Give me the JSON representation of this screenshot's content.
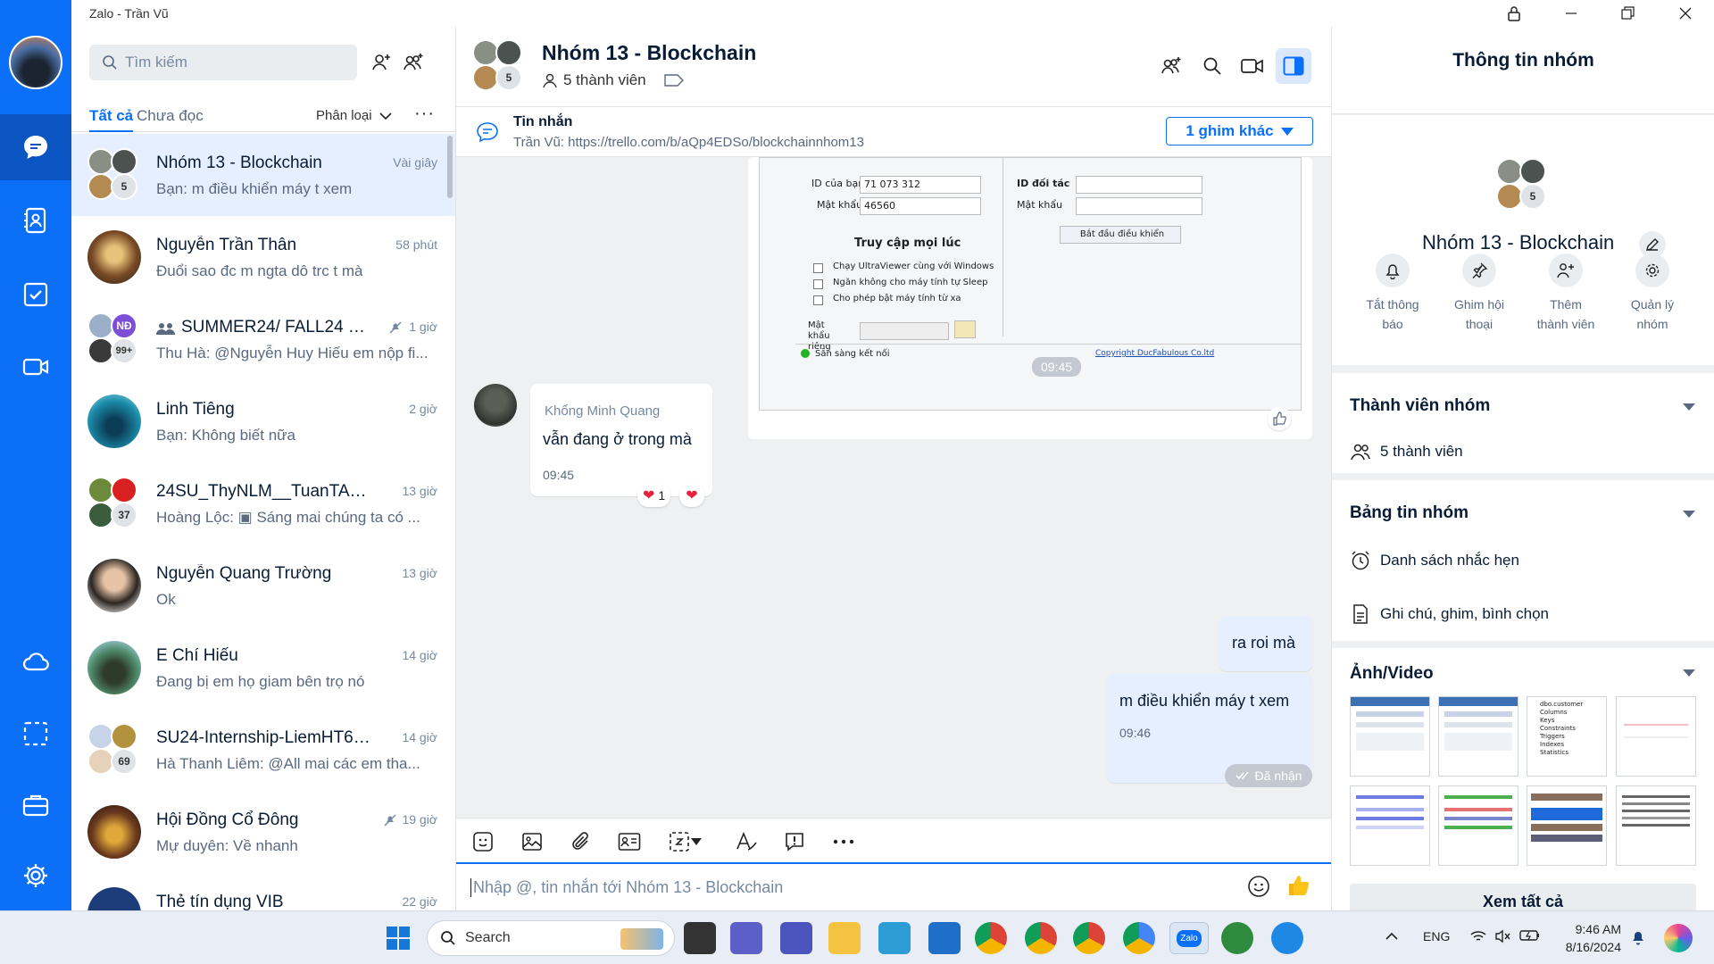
{
  "window": {
    "title": "Zalo - Trần Vũ"
  },
  "convlist": {
    "search_placeholder": "Tìm kiếm",
    "tab_all": "Tất cả",
    "tab_unread": "Chưa đọc",
    "filter": "Phân loại",
    "more": "···",
    "items": [
      {
        "name": "Nhóm 13 - Blockchain",
        "time": "Vài giây",
        "preview": "Bạn: m điều khiển máy t xem",
        "count": "5"
      },
      {
        "name": "Nguyễn Trần Thân",
        "time": "58 phút",
        "preview": "Đuổi sao đc m ngta dô trc t mà"
      },
      {
        "name": "SUMMER24/ FALL24 - ...",
        "time": "1 giờ",
        "preview": "Thu Hà: @Nguyễn Huy Hiếu em nộp fi...",
        "count": "99+",
        "badge": "NĐ"
      },
      {
        "name": "Linh Tiêng",
        "time": "2 giờ",
        "preview": "Bạn: Không biết nữa"
      },
      {
        "name": "24SU_ThyNLM__TuanTA_TT...",
        "time": "13 giờ",
        "preview": "Hoàng Lộc: ▣ Sáng mai chúng ta có ...",
        "count": "37"
      },
      {
        "name": "Nguyễn Quang Trường",
        "time": "13 giờ",
        "preview": "Ok"
      },
      {
        "name": "E Chí Hiếu",
        "time": "14 giờ",
        "preview": "Đang bị em họ giam bên trọ nó"
      },
      {
        "name": "SU24-Internship-LiemHT6_...",
        "time": "14 giờ",
        "preview": "Hà Thanh Liêm: @All mai các em tha...",
        "count": "69"
      },
      {
        "name": "Hội Đồng Cổ Đông",
        "time": "19 giờ",
        "preview": "Mự duyên: Về nhanh"
      },
      {
        "name": "Thẻ tín dụng VIB",
        "time": "22 giờ",
        "preview": ""
      }
    ]
  },
  "chat": {
    "title": "Nhóm 13 - Blockchain",
    "members": "5 thành viên",
    "avatar_count": "5",
    "pin_label": "Tin nhắn",
    "pin_text": "Trần Vũ: https://trello.com/b/aQp4EDSo/blockchainnhom13",
    "pin_button": "1 ghim khác",
    "image_time": "09:45",
    "ultraviewer": {
      "your_id_label": "ID của bạn",
      "your_id": "71 073 312",
      "password_label": "Mật khẩu",
      "password": "46560",
      "partner_id_label": "ID đối tác",
      "partner_password_label": "Mật khẩu",
      "start_button": "Bắt đầu điều khiển",
      "access_title": "Truy cập mọi lúc",
      "opt1": "Chạy UltraViewer cùng với Windows",
      "opt2": "Ngăn không cho máy tính tự Sleep",
      "opt3": "Cho phép bật máy tính từ xa",
      "private_pw_label": "Mật khẩu riêng",
      "status": "Sẵn sàng kết nối",
      "copyright": "Copyright DucFabulous Co.ltd"
    },
    "msg1": {
      "sender": "Khổng Minh Quang",
      "text": "vẫn đang ở trong mà",
      "time": "09:45",
      "reaction_count": "1"
    },
    "msg2": {
      "text": "ra roi mà"
    },
    "msg3": {
      "text": "m điều khiển máy t xem",
      "time": "09:46"
    },
    "received": "Đã nhận",
    "composer_placeholder": "Nhập @, tin nhắn tới Nhóm 13 - Blockchain"
  },
  "info": {
    "title": "Thông tin nhóm",
    "group_name": "Nhóm 13 - Blockchain",
    "avatar_count": "5",
    "actions": [
      {
        "l1": "Tắt thông",
        "l2": "báo"
      },
      {
        "l1": "Ghim hội",
        "l2": "thoại"
      },
      {
        "l1": "Thêm",
        "l2": "thành viên"
      },
      {
        "l1": "Quản lý",
        "l2": "nhóm"
      }
    ],
    "members_title": "Thành viên nhóm",
    "members_count": "5 thành viên",
    "board_title": "Bảng tin nhóm",
    "reminders": "Danh sách nhắc hẹn",
    "notes": "Ghi chú, ghim, bình chọn",
    "media_title": "Ảnh/Video",
    "see_all": "Xem tất cả",
    "thumb3_lines": [
      "dbo.customer",
      "Columns",
      "Keys",
      "Constraints",
      "Triggers",
      "Indexes",
      "Statistics"
    ]
  },
  "taskbar": {
    "search": "Search",
    "lang": "ENG",
    "time": "9:46 AM",
    "date": "8/16/2024",
    "zalo_label": "Zalo"
  },
  "colors": {
    "accent": "#0b6ff7",
    "nav": "#0b6ff7",
    "selected_row": "#e5efff"
  }
}
